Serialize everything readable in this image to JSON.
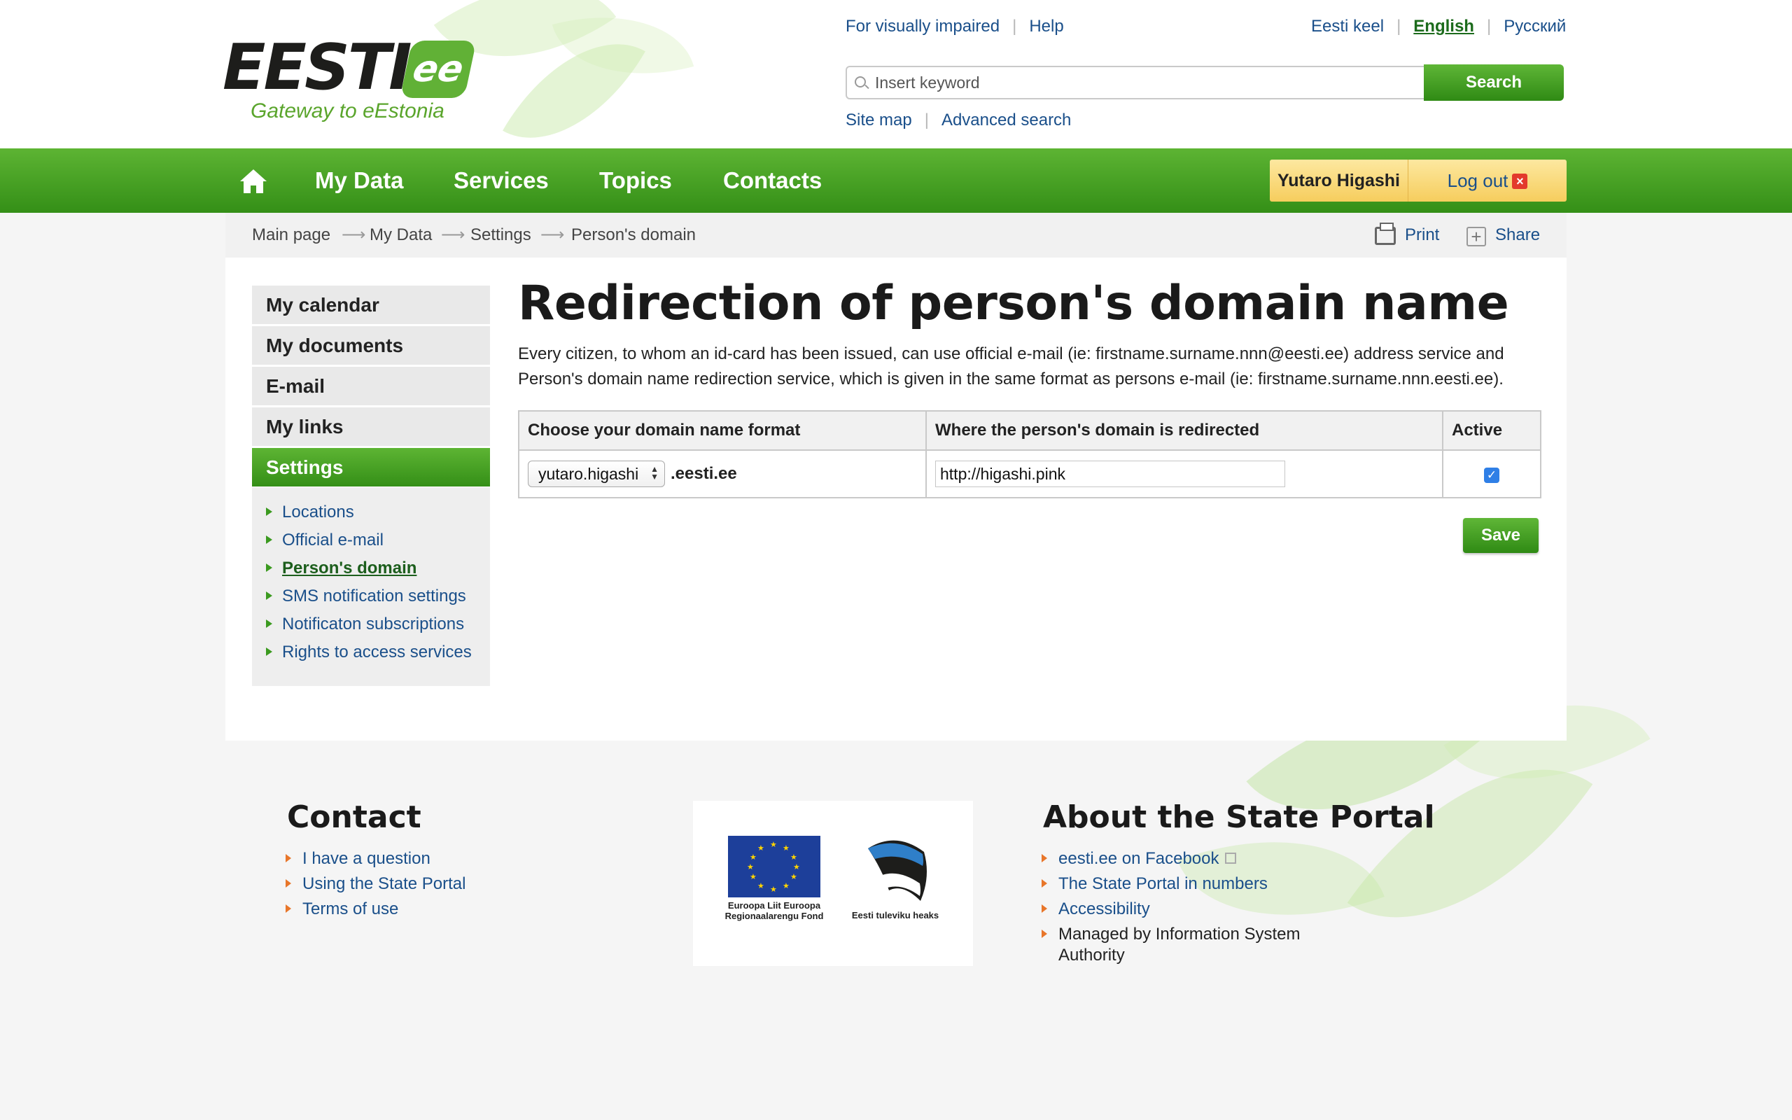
{
  "header": {
    "logo_text": "EESTI",
    "logo_badge": "ee",
    "tagline": "Gateway to eEstonia",
    "utility_links": [
      "For visually impaired",
      "Help"
    ],
    "languages": [
      "Eesti keel",
      "English",
      "Русский"
    ],
    "active_language": "English",
    "search": {
      "placeholder": "Insert keyword",
      "value": "",
      "button": "Search"
    },
    "sub_links": [
      "Site map",
      "Advanced search"
    ]
  },
  "nav": {
    "items": [
      "My Data",
      "Services",
      "Topics",
      "Contacts"
    ],
    "user_name": "Yutaro Higashi",
    "logout_label": "Log out"
  },
  "breadcrumb": [
    "Main page",
    "My Data",
    "Settings",
    "Person's domain"
  ],
  "tools": {
    "print": "Print",
    "share": "Share"
  },
  "sidebar": {
    "items": [
      "My calendar",
      "My documents",
      "E-mail",
      "My links",
      "Settings"
    ],
    "active": "Settings",
    "sub_items": [
      "Locations",
      "Official e-mail",
      "Person's domain",
      "SMS notification settings",
      "Notificaton subscriptions",
      "Rights to access services"
    ],
    "current_sub": "Person's domain"
  },
  "main": {
    "title": "Redirection of person's domain name",
    "intro": "Every citizen, to whom an id-card has been issued, can use official e-mail (ie: firstname.surname.nnn@eesti.ee) address service and Person's domain name redirection service, which is given in the same format as persons e-mail (ie: firstname.surname.nnn.eesti.ee).",
    "table": {
      "headers": [
        "Choose your domain name format",
        "Where the person's domain is redirected",
        "Active"
      ],
      "row": {
        "domain_select": "yutaro.higashi",
        "domain_suffix": ".eesti.ee",
        "redirect_url": "http://higashi.pink",
        "active": true
      }
    },
    "save_button": "Save"
  },
  "footer": {
    "contact": {
      "heading": "Contact",
      "links": [
        "I have a question",
        "Using the State Portal",
        "Terms of use"
      ]
    },
    "logos": {
      "eu_text": "Euroopa Liit Euroopa Regionaalarengu Fond",
      "ee_text": "Eesti tuleviku heaks"
    },
    "about": {
      "heading": "About the State Portal",
      "links": [
        "eesti.ee on Facebook",
        "The State Portal in numbers",
        "Accessibility"
      ],
      "note": "Managed by Information System Authority"
    }
  },
  "colors": {
    "brand_green": "#4aa126",
    "link_blue": "#1a4f8a",
    "user_box": "#f8d56d",
    "checkbox_blue": "#2f7fe6",
    "bullet_orange": "#e8762a"
  }
}
